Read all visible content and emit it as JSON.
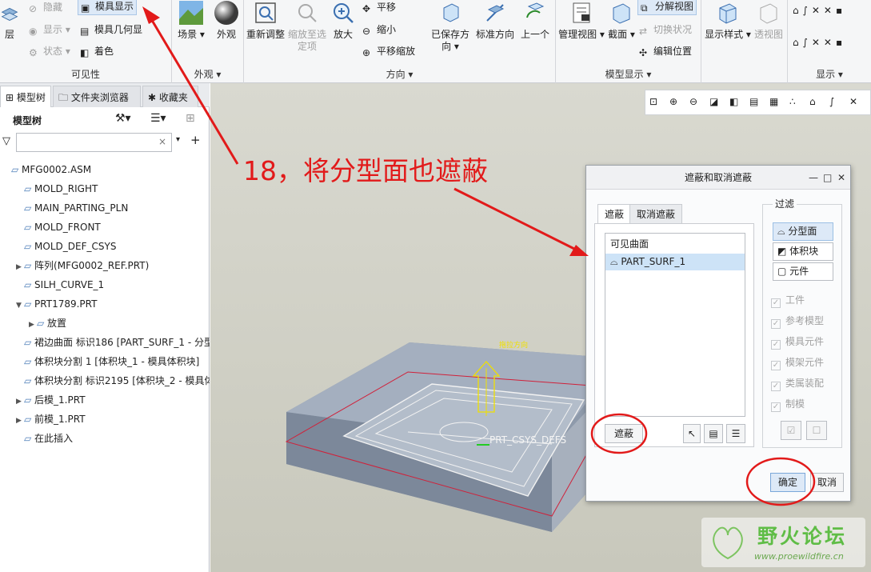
{
  "ribbon": {
    "visibility": {
      "label": "可见性",
      "layer": "层",
      "hide": "隐藏",
      "show": "显示",
      "status": "状态",
      "mold_display": "模具显示",
      "mold_geometry": "模具几何显",
      "shading": "着色"
    },
    "appearance": {
      "label": "外观",
      "scene": "场景",
      "appearance_btn": "外观"
    },
    "orientation": {
      "label": "方向",
      "refit": "重新调整",
      "zoom_selected": "缩放至选定项",
      "zoom_in": "放大",
      "pan": "平移",
      "zoom_out": "缩小",
      "pan_zoom": "平移缩放",
      "saved_orient": "已保存方向",
      "standard_orient": "标准方向",
      "previous": "上一个"
    },
    "model_display": {
      "label": "模型显示",
      "manage_views": "管理视图",
      "section": "截面",
      "exploded": "分解视图",
      "toggle_status": "切换状况",
      "edit_position": "编辑位置"
    },
    "display": {
      "label": "显示",
      "display_style": "显示样式",
      "perspective": "透视图"
    }
  },
  "left_panel": {
    "tabs": [
      "模型树",
      "文件夹浏览器",
      "收藏夹"
    ],
    "tree_title": "模型树",
    "items": [
      {
        "label": "MFG0002.ASM",
        "indent": 0,
        "arrow": ""
      },
      {
        "label": "MOLD_RIGHT",
        "indent": 1,
        "arrow": ""
      },
      {
        "label": "MAIN_PARTING_PLN",
        "indent": 1,
        "arrow": ""
      },
      {
        "label": "MOLD_FRONT",
        "indent": 1,
        "arrow": ""
      },
      {
        "label": "MOLD_DEF_CSYS",
        "indent": 1,
        "arrow": ""
      },
      {
        "label": "阵列(MFG0002_REF.PRT)",
        "indent": 1,
        "arrow": "▶"
      },
      {
        "label": "SILH_CURVE_1",
        "indent": 1,
        "arrow": ""
      },
      {
        "label": "PRT1789.PRT",
        "indent": 1,
        "arrow": "▼"
      },
      {
        "label": "放置",
        "indent": 2,
        "arrow": "▶"
      },
      {
        "label": "裙边曲面 标识186 [PART_SURF_1 - 分型",
        "indent": 1,
        "arrow": ""
      },
      {
        "label": "体积块分割 1 [体积块_1 - 模具体积块]",
        "indent": 1,
        "arrow": ""
      },
      {
        "label": "体积块分割 标识2195 [体积块_2 - 模具体",
        "indent": 1,
        "arrow": ""
      },
      {
        "label": "后模_1.PRT",
        "indent": 1,
        "arrow": "▶"
      },
      {
        "label": "前模_1.PRT",
        "indent": 1,
        "arrow": "▶"
      },
      {
        "label": "在此插入",
        "indent": 1,
        "arrow": ""
      }
    ]
  },
  "viewport": {
    "pull_direction": "拖拉方向",
    "csys_label": "PRT_CSYS_DEFS"
  },
  "dialog": {
    "title": "遮蔽和取消遮蔽",
    "tabs": [
      "遮蔽",
      "取消遮蔽"
    ],
    "list_header": "可见曲面",
    "list_item": "PART_SURF_1",
    "blank_button": "遮蔽",
    "ok": "确定",
    "cancel": "取消",
    "filter_label": "过滤",
    "filter_buttons": [
      "分型面",
      "体积块",
      "元件"
    ],
    "filter_checks": [
      "工件",
      "参考模型",
      "模具元件",
      "模架元件",
      "类属装配",
      "制模"
    ]
  },
  "annotation": {
    "text": "18，将分型面也遮蔽",
    "color": "#e21a1a"
  },
  "watermark": {
    "title": "野火论坛",
    "url": "www.proewildfire.cn"
  }
}
